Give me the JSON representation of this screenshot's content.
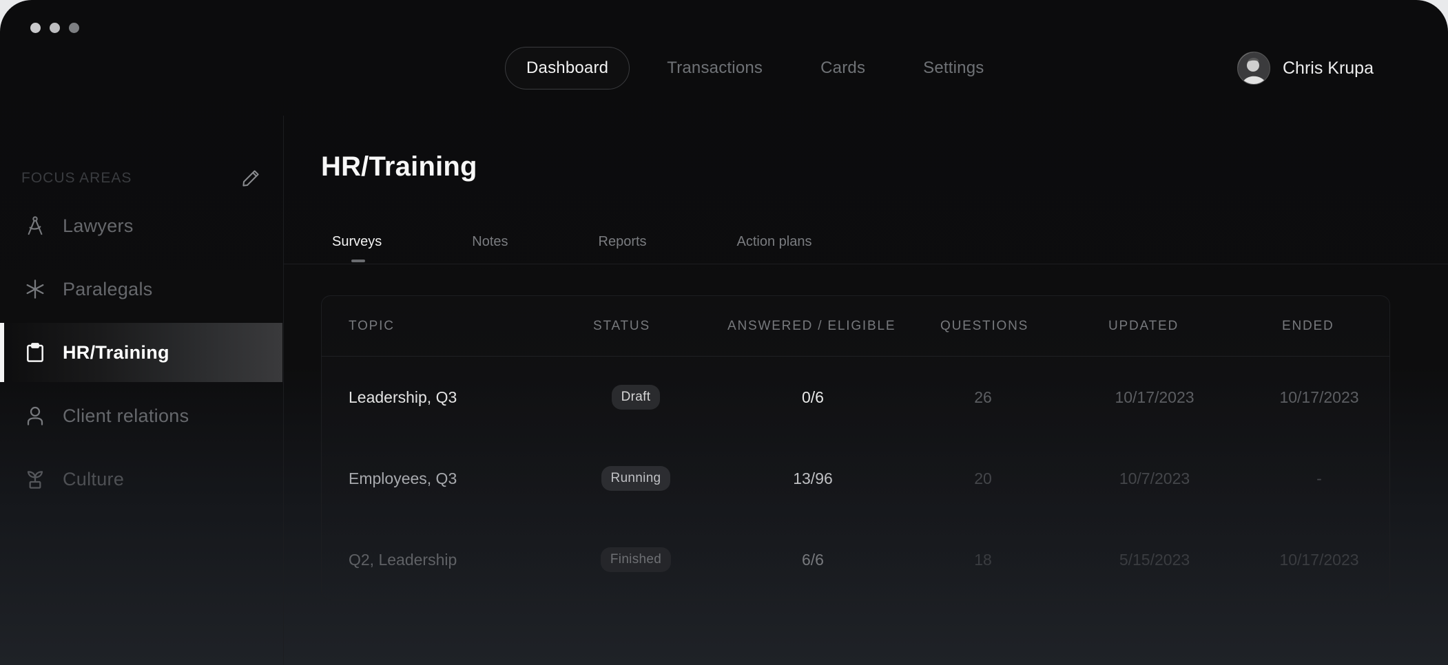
{
  "window": {
    "controls": [
      "close",
      "minimize",
      "maximize"
    ]
  },
  "topnav": {
    "items": [
      {
        "label": "Dashboard",
        "active": true
      },
      {
        "label": "Transactions",
        "active": false
      },
      {
        "label": "Cards",
        "active": false
      },
      {
        "label": "Settings",
        "active": false
      }
    ]
  },
  "user": {
    "name": "Chris Krupa",
    "avatar_icon": "avatar-photo"
  },
  "sidebar": {
    "title": "FOCUS AREAS",
    "edit_icon": "pencil-icon",
    "items": [
      {
        "label": "Lawyers",
        "icon": "compass-icon",
        "active": false
      },
      {
        "label": "Paralegals",
        "icon": "asterisk-icon",
        "active": false
      },
      {
        "label": "HR/Training",
        "icon": "clipboard-icon",
        "active": true
      },
      {
        "label": "Client relations",
        "icon": "person-icon",
        "active": false
      },
      {
        "label": "Culture",
        "icon": "sprout-icon",
        "active": false
      }
    ]
  },
  "main": {
    "title": "HR/Training",
    "tabs": [
      {
        "label": "Surveys",
        "active": true
      },
      {
        "label": "Notes",
        "active": false
      },
      {
        "label": "Reports",
        "active": false
      },
      {
        "label": "Action plans",
        "active": false
      }
    ],
    "table": {
      "columns": [
        "TOPIC",
        "STATUS",
        "ANSWERED / ELIGIBLE",
        "QUESTIONS",
        "UPDATED",
        "ENDED"
      ],
      "rows": [
        {
          "topic": "Leadership, Q3",
          "status": "Draft",
          "answered": "0/6",
          "questions": "26",
          "updated": "10/17/2023",
          "ended": "10/17/2023"
        },
        {
          "topic": "Employees, Q3",
          "status": "Running",
          "answered": "13/96",
          "questions": "20",
          "updated": "10/7/2023",
          "ended": "-"
        },
        {
          "topic": "Q2, Leadership",
          "status": "Finished",
          "answered": "6/6",
          "questions": "18",
          "updated": "5/15/2023",
          "ended": "10/17/2023"
        }
      ]
    }
  },
  "colors": {
    "background": "#0c0c0d",
    "accent": "#ffffff",
    "muted": "#66686c"
  }
}
